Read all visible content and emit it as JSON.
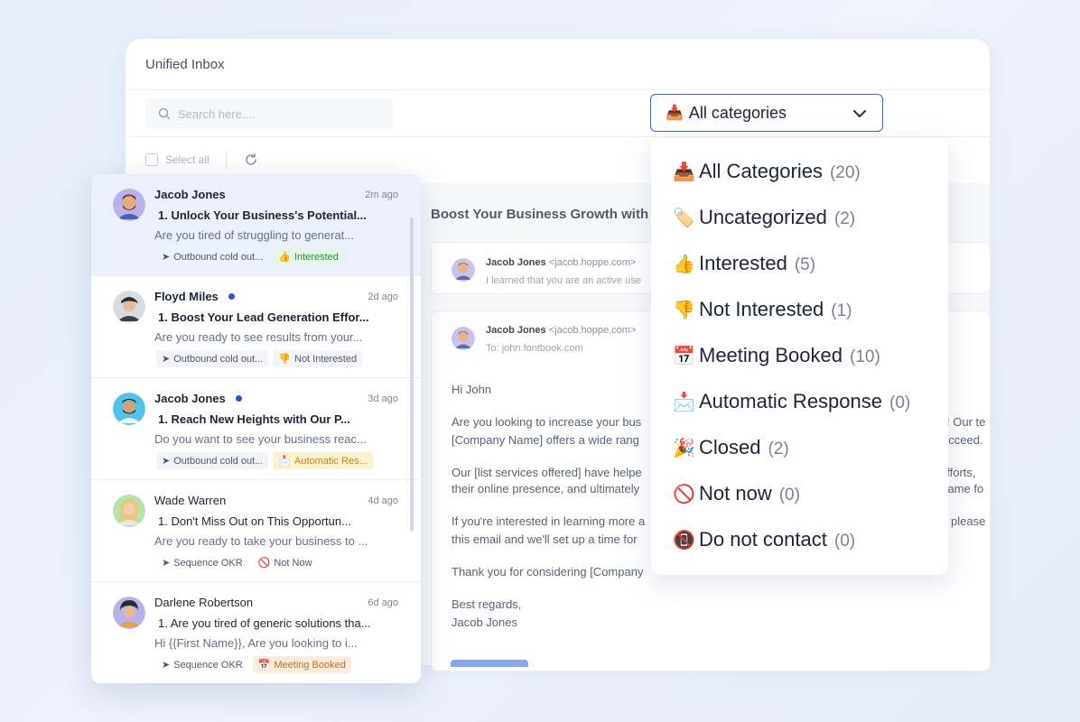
{
  "window": {
    "title": "Unified Inbox"
  },
  "toolbar": {
    "search_placeholder": "Search here....",
    "select_all_label": "Select all"
  },
  "category_filter": {
    "selected_emoji": "📥",
    "selected_label": "All categories",
    "options": [
      {
        "emoji": "📥",
        "name": "All Categories",
        "count": "(20)"
      },
      {
        "emoji": "🏷️",
        "name": "Uncategorized",
        "count": "(2)"
      },
      {
        "emoji": "👍",
        "name": "Interested",
        "count": "(5)"
      },
      {
        "emoji": "👎",
        "name": "Not Interested",
        "count": "(1)"
      },
      {
        "emoji": "📅",
        "name": "Meeting Booked",
        "count": "(10)"
      },
      {
        "emoji": "📩",
        "name": "Automatic Response",
        "count": "(0)"
      },
      {
        "emoji": "🎉",
        "name": "Closed",
        "count": "(2)"
      },
      {
        "emoji": "🚫",
        "name": "Not now",
        "count": "(0)"
      },
      {
        "emoji": "📵",
        "name": "Do not contact",
        "count": "(0)"
      }
    ]
  },
  "messages": [
    {
      "name": "Jacob Jones",
      "unread": false,
      "time": "2m ago",
      "subject": "1. Unlock Your Business's Potential...",
      "preview": "Are you tired of struggling to generat...",
      "campaign": "Outbound cold out...",
      "label_emoji": "👍",
      "label": "Interested",
      "label_color": "#2f8a46"
    },
    {
      "name": "Floyd Miles",
      "unread": true,
      "time": "2d ago",
      "subject": "1. Boost Your Lead Generation Effor...",
      "preview": "Are you ready to see results from your...",
      "campaign": "Outbound cold out...",
      "label_emoji": "👎",
      "label": "Not Interested",
      "label_color": "#50576a"
    },
    {
      "name": "Jacob Jones",
      "unread": true,
      "time": "3d ago",
      "subject": "1. Reach New Heights with Our P...",
      "preview": "Do you want to see your business reac...",
      "campaign": "Outbound cold out...",
      "label_emoji": "📩",
      "label": "Automatic Res...",
      "label_color": "#b8841c"
    },
    {
      "name": "Wade Warren",
      "unread": false,
      "time": "4d ago",
      "subject": "1. Don't Miss Out on This Opportun...",
      "preview": "Are you ready to take your business to ...",
      "campaign": "Sequence OKR",
      "label_emoji": "🚫",
      "label": "Not Now",
      "label_color": "#50576a"
    },
    {
      "name": "Darlene Robertson",
      "unread": false,
      "time": "6d ago",
      "subject": "1. Are you tired of generic solutions tha...",
      "preview": "Hi {{First Name}}, Are you looking to i...",
      "campaign": "Sequence OKR",
      "label_emoji": "📅",
      "label": "Meeting Booked",
      "label_color": "#c06a22"
    }
  ],
  "reader": {
    "subject": "Boost Your Business Growth with O",
    "thread": [
      {
        "from_name": "Jacob Jones",
        "from_email": "<jacob.hoppe.com>",
        "snippet": "I learned that you are an active use"
      },
      {
        "from_name": "Jacob Jones",
        "from_email": "<jacob.hoppe.com>",
        "to": "To: john.fontbook.com"
      }
    ],
    "body": {
      "greeting": "Hi John",
      "p1_l1": "Are you looking to increase your bus",
      "p1_l1_end": "! Our te",
      "p1_l2": "[Company Name] offers a wide rang",
      "p1_l2_end": "ucceed.",
      "p2_l1": "Our [list services offered] have helpe",
      "p2_l1_end": "efforts,",
      "p2_l2": "their online presence, and ultimately",
      "p2_l2_end": "same fo",
      "p3_l1": "If you're interested in learning more a",
      "p3_l1_end": "please",
      "p3_l2": "this email and we'll set up a time for",
      "p4": "Thank you for considering [Company",
      "sign1": "Best regards,",
      "sign2": "Jacob Jones"
    }
  }
}
